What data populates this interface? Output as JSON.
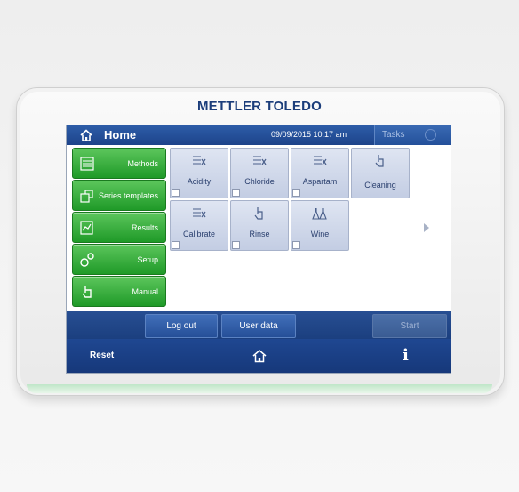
{
  "brand": "METTLER TOLEDO",
  "topbar": {
    "title": "Home",
    "datetime": "09/09/2015 10:17 am",
    "tasks_label": "Tasks",
    "icon": "home-icon"
  },
  "sidebar": {
    "items": [
      {
        "label": "Methods",
        "icon": "methods-icon"
      },
      {
        "label": "Series templates",
        "icon": "series-templates-icon"
      },
      {
        "label": "Results",
        "icon": "results-icon"
      },
      {
        "label": "Setup",
        "icon": "setup-icon"
      },
      {
        "label": "Manual",
        "icon": "hand-pointer-icon"
      }
    ]
  },
  "tiles": [
    {
      "label": "Acidity",
      "icon": "method-icon"
    },
    {
      "label": "Chloride",
      "icon": "method-icon"
    },
    {
      "label": "Aspartam",
      "icon": "method-icon"
    },
    {
      "label": "Cleaning",
      "icon": "hand-pointer-icon"
    },
    {
      "label": "Calibrate",
      "icon": "method-icon"
    },
    {
      "label": "Rinse",
      "icon": "hand-pointer-icon"
    },
    {
      "label": "Wine",
      "icon": "flasks-icon"
    }
  ],
  "action_bar": {
    "logout_label": "Log out",
    "userdata_label": "User data",
    "start_label": "Start"
  },
  "footer": {
    "reset_label": "Reset",
    "home_icon": "home-icon",
    "info_label": "i"
  },
  "colors": {
    "brand_blue": "#1b3d7a",
    "bar_blue": "#1d438a",
    "button_green": "#1f9a28",
    "tile_lavender": "#c3cde3"
  }
}
